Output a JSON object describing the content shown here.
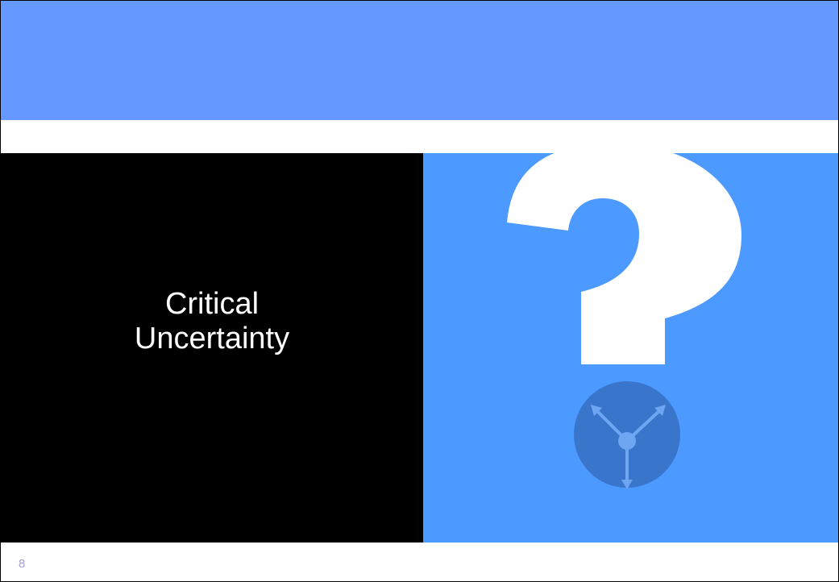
{
  "slide": {
    "title_lines": [
      "Critical",
      "Uncertainty"
    ],
    "slide_number": "8"
  },
  "graphic": {
    "icon": "question-mark-icon",
    "dot_icon": "branching-arrows-icon"
  },
  "colors": {
    "header_band": "#6699ff",
    "left_panel": "#000000",
    "right_panel": "#4c99ff",
    "question_mark": "#ffffff",
    "dot": "#3a75cc",
    "arrows": "#6fa6f2",
    "slide_number": "#a59fd6"
  }
}
